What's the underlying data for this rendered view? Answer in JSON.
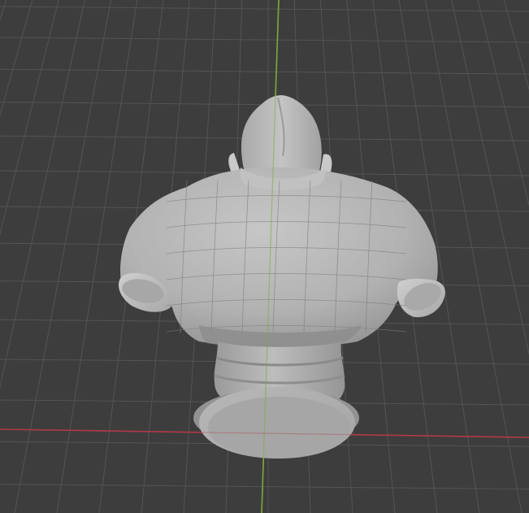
{
  "viewport": {
    "background_color": "#3d3d3d",
    "grid_color": "#545454",
    "x_axis_color": "#b03a48",
    "y_axis_color": "#7fa83a",
    "model_color": "#b3b3b3",
    "model_shadow_color": "#8a8a8a",
    "model_highlight_color": "#c8c8c8",
    "model_wireframe_color": "#7e7e7e",
    "model_name": "bust-sculpture"
  }
}
